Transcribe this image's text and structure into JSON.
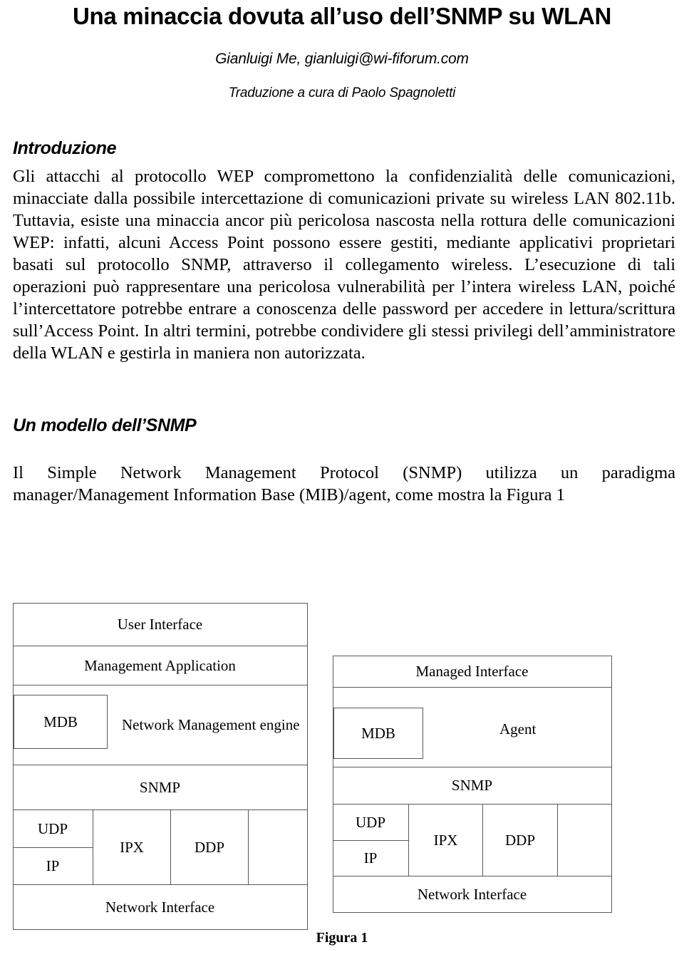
{
  "document": {
    "title": "Una minaccia dovuta all’uso dell’SNMP su WLAN",
    "author_line": "Gianluigi Me, gianluigi@wi-fiforum.com",
    "translator_line": "Traduzione a cura di Paolo Spagnoletti"
  },
  "sections": [
    {
      "heading": "Introduzione",
      "paragraph": "Gli attacchi al protocollo WEP compromettono la confidenzialità delle comunicazioni, minacciate dalla possibile intercettazione di comunicazioni private su wireless LAN 802.11b. Tuttavia, esiste una minaccia ancor più pericolosa nascosta nella rottura delle comunicazioni WEP: infatti, alcuni Access Point possono essere gestiti, mediante applicativi proprietari basati sul protocollo SNMP, attraverso il collegamento wireless. L’esecuzione di tali operazioni può rappresentare una pericolosa vulnerabilità per l’intera wireless LAN, poiché l’intercettatore potrebbe entrare a conoscenza delle password per accedere in lettura/scrittura sull’Access Point. In altri termini, potrebbe condividere gli stessi privilegi dell’amministratore della WLAN e gestirla in maniera non autorizzata."
    },
    {
      "heading": "Un modello dell’SNMP",
      "paragraph": "Il Simple Network Management Protocol (SNMP) utilizza un paradigma manager/Management Information Base (MIB)/agent, come mostra la Figura 1"
    }
  ],
  "figure": {
    "caption": "Figura 1",
    "manager_stack": {
      "user_interface": "User Interface",
      "management_application": "Management Application",
      "mdb": "MDB",
      "engine": "Network Management engine",
      "snmp": "SNMP",
      "udp": "UDP",
      "ip": "IP",
      "ipx": "IPX",
      "ddp": "DDP",
      "network_interface": "Network Interface"
    },
    "agent_stack": {
      "managed_interface": "Managed Interface",
      "mdb": "MDB",
      "agent": "Agent",
      "snmp": "SNMP",
      "udp": "UDP",
      "ip": "IP",
      "ipx": "IPX",
      "ddp": "DDP",
      "network_interface": "Network  Interface"
    }
  },
  "colors": {
    "text": "#000000",
    "rule": "#555a5e",
    "background": "#ffffff"
  }
}
